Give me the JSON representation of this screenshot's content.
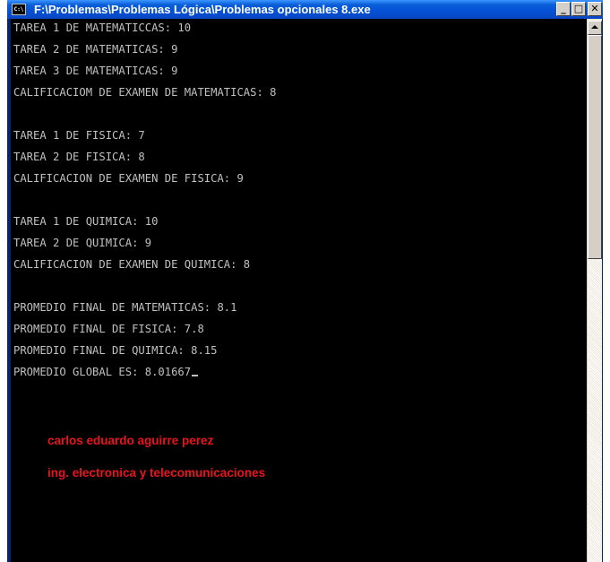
{
  "window": {
    "title": "F:\\Problemas\\Problemas Lógica\\Problemas opcionales 8.exe",
    "app_icon": "C:\\",
    "buttons": {
      "minimize": "_",
      "maximize": "□",
      "close": "✕"
    }
  },
  "console": {
    "lines": [
      "TAREA 1 DE MATEMATICCAS: 10",
      "TAREA 2 DE MATEMATICAS: 9",
      "TAREA 3 DE MATEMATICAS: 9",
      "CALIFICACIOM DE EXAMEN DE MATEMATICAS: 8",
      "",
      "TAREA 1 DE FISICA: 7",
      "TAREA 2 DE FISICA: 8",
      "CALIFICACION DE EXAMEN DE FISICA: 9",
      "",
      "TAREA 1 DE QUIMICA: 10",
      "TAREA 2 DE QUIMICA: 9",
      "CALIFICACION DE EXAMEN DE QUIMICA: 8",
      "",
      "PROMEDIO FINAL DE MATEMATICAS: 8.1",
      "PROMEDIO FINAL DE FISICA: 7.8",
      "PROMEDIO FINAL DE QUIMICA: 8.15",
      "PROMEDIO GLOBAL ES: 8.01667"
    ],
    "credit_name": "carlos eduardo aguirre perez",
    "credit_career": "ing. electronica y telecomunicaciones",
    "text_color": "#c0c0c0",
    "credit_color": "#e8141e",
    "background": "#000000"
  },
  "scrollbar": {
    "up_arrow_icon": "scroll-up-arrow-icon"
  }
}
